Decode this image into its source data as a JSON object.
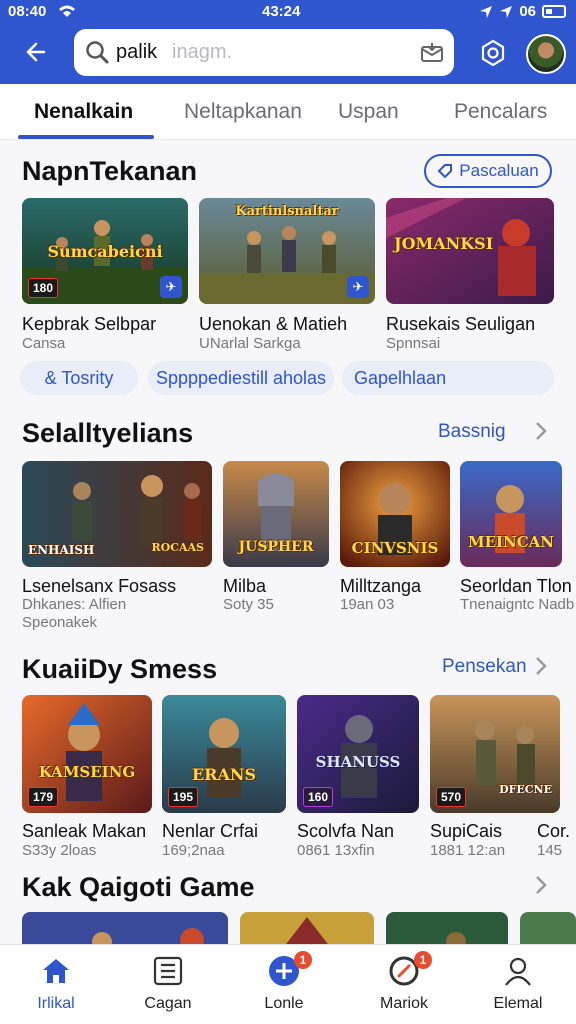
{
  "status_bar": {
    "time_left": "08:40",
    "time_center": "43:24",
    "right_text": "06"
  },
  "search": {
    "value": "palik",
    "placeholder": "inagm."
  },
  "tabs": [
    {
      "label": "Nenalkain",
      "active": true
    },
    {
      "label": "Neltapkanan",
      "active": false
    },
    {
      "label": "Uspan",
      "active": false
    },
    {
      "label": "Pencalars",
      "active": false
    }
  ],
  "section1": {
    "title": "NapnTekanan",
    "action_label": "Pascaluan",
    "cards": [
      {
        "title": "Kepbrak Selbpar",
        "subtitle": "Cansa",
        "overlay": "Sumcabeicni",
        "badge": "180"
      },
      {
        "title": "Uenokan & Matieh",
        "subtitle": "UNarlal Sarkga",
        "overlay": "Kartinlsnaltar"
      },
      {
        "title": "Rusekais Seuligan",
        "subtitle": "Spnnsai",
        "overlay": "JOMANKSI"
      }
    ],
    "chips": [
      "& Tosrity",
      "Sppppediestill aholas",
      "Gapelhlaan"
    ]
  },
  "section2": {
    "title": "Selalltyelians",
    "action_label": "Bassnig",
    "cards": [
      {
        "title": "Lsenelsanx Fosass",
        "subtitle": "Dhkanes: Alfien",
        "subtitle2": "Speonakek",
        "overlay": "ENHAISH",
        "overlay2": "ROCAAS"
      },
      {
        "title": "Milba",
        "subtitle": "Soty 35",
        "overlay": "JUSPHER"
      },
      {
        "title": "Milltzanga",
        "subtitle": "19an 03",
        "overlay": "CINVSNIS"
      },
      {
        "title": "Seorldan Tlon",
        "subtitle": "Tnenaigntc Nadb",
        "overlay": "MEINCAN"
      }
    ]
  },
  "section3": {
    "title": "KuaiiDy Smess",
    "action_label": "Pensekan",
    "cards": [
      {
        "title": "Sanleak Makan",
        "subtitle": "S33y 2loas",
        "overlay": "KAMSEING",
        "badge": "179"
      },
      {
        "title": "Nenlar Crfai",
        "subtitle": "169;2naa",
        "overlay": "ERANS",
        "badge": "195"
      },
      {
        "title": "Scolvfa Nan",
        "subtitle": "0861 13xfin",
        "overlay": "SHANUSS",
        "badge": "160"
      },
      {
        "title": "SupiCais",
        "subtitle": "1881 12:an",
        "overlay": "DFECNE",
        "badge": "570"
      },
      {
        "title": "Cor.",
        "subtitle": "145"
      }
    ]
  },
  "section4": {
    "title": "Kak Qaigoti Game"
  },
  "bottom_nav": [
    {
      "label": "Irlikal",
      "icon": "home-icon",
      "active": true
    },
    {
      "label": "Cagan",
      "icon": "list-icon",
      "active": false
    },
    {
      "label": "Lonle",
      "icon": "add-icon",
      "active": false,
      "badge": "1"
    },
    {
      "label": "Mariok",
      "icon": "compass-icon",
      "active": false,
      "badge": "1"
    },
    {
      "label": "Elemal",
      "icon": "profile-icon",
      "active": false
    }
  ],
  "colors": {
    "brand": "#2f55cf",
    "background": "#f7f7f9",
    "chip_bg": "#e8edf8",
    "notif": "#e84b2d"
  }
}
